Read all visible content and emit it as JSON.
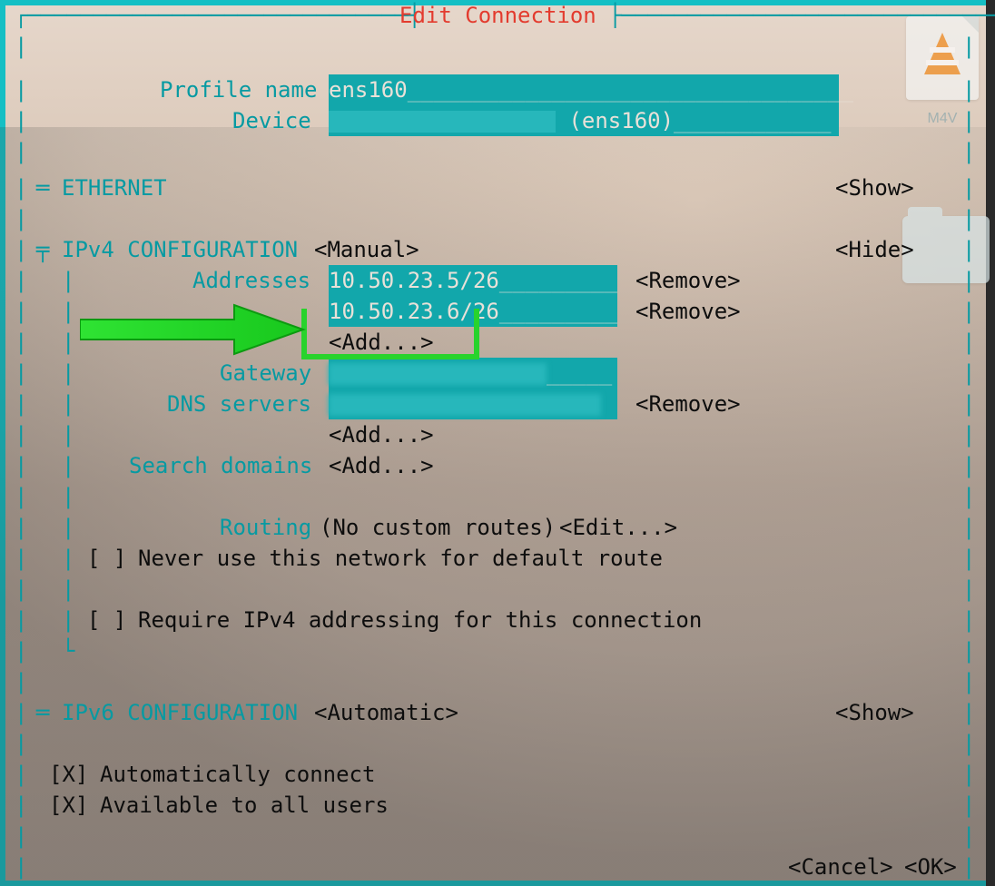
{
  "title": "Edit Connection",
  "labels": {
    "profile_name": "Profile name",
    "device": "Device",
    "ethernet": "ETHERNET",
    "ipv4_conf": "IPv4 CONFIGURATION",
    "addresses": "Addresses",
    "gateway": "Gateway",
    "dns_servers": "DNS servers",
    "search_domains": "Search domains",
    "routing": "Routing",
    "ipv6_conf": "IPv6 CONFIGURATION"
  },
  "values": {
    "profile_name": "ens160",
    "device_suffix": "(ens160)",
    "ipv4_mode": "<Manual>",
    "addresses": [
      "10.50.23.5/26",
      "10.50.23.6/26"
    ],
    "routing_status": "(No custom routes)",
    "ipv6_mode": "<Automatic>"
  },
  "buttons": {
    "show": "<Show>",
    "hide": "<Hide>",
    "remove": "<Remove>",
    "add": "<Add...>",
    "edit": "<Edit...>",
    "cancel": "<Cancel>",
    "ok": "<OK>"
  },
  "checkboxes": {
    "never_default": {
      "checked": false,
      "label": "Never use this network for default route"
    },
    "require_ipv4": {
      "checked": false,
      "label": "Require IPv4 addressing for this connection"
    },
    "auto_connect": {
      "checked": true,
      "label": "Automatically connect"
    },
    "all_users": {
      "checked": true,
      "label": "Available to all users"
    }
  },
  "desktop": {
    "m4v_label": "M4V"
  },
  "border": {
    "corner_tl": "┌",
    "corner_tr": "┐",
    "dash": "─",
    "pipe": "|",
    "tee_left": "├",
    "tee_right": "┤",
    "equal": "═",
    "tee_double": "╤",
    "ell": "└"
  }
}
